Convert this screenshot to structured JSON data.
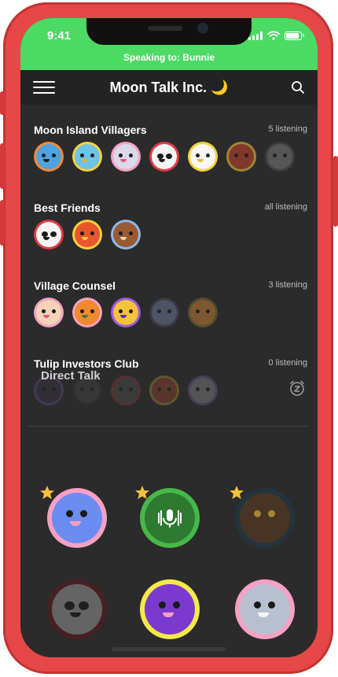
{
  "status_bar": {
    "time": "9:41",
    "speaking": "Speaking to: Bunnie"
  },
  "header": {
    "title": "Moon Talk Inc. 🌙"
  },
  "groups": [
    {
      "name": "Moon Island Villagers",
      "count": "5 listening"
    },
    {
      "name": "Best Friends",
      "count": "all listening"
    },
    {
      "name": "Village Counsel",
      "count": "3 listening"
    },
    {
      "name": "Tulip Investors Club",
      "count": "0 listening"
    }
  ],
  "direct_talk": {
    "title": "Direct Talk"
  },
  "colors": {
    "accent_green": "#4cd964",
    "phone_red": "#e64747",
    "screen_bg": "#2b2b2b",
    "star": "#f5c23b"
  }
}
